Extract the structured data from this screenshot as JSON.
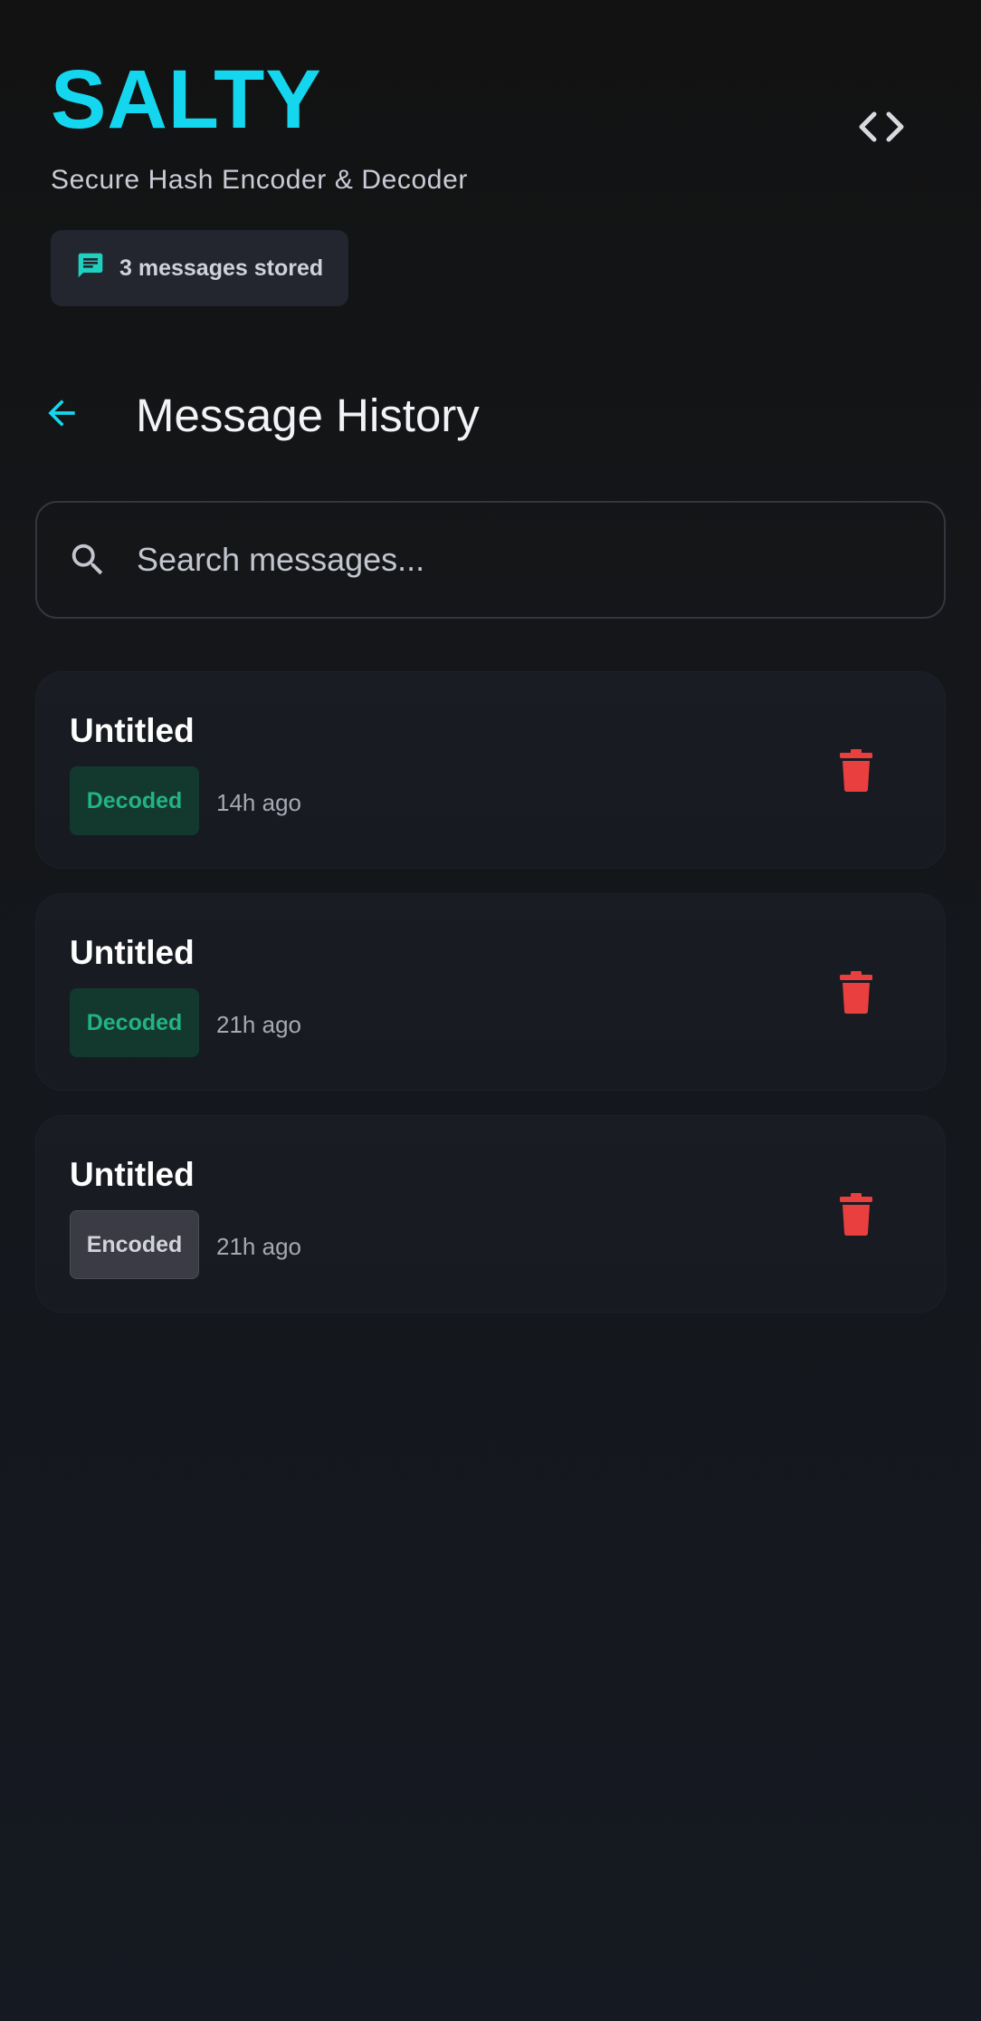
{
  "header": {
    "brand": "SALTY",
    "subtitle": "Secure Hash Encoder & Decoder",
    "badge_text": "3 messages stored",
    "badge_icon": "message-icon",
    "toggle_icon": "code-icon"
  },
  "page": {
    "title": "Message History",
    "back_icon": "arrow-left-icon"
  },
  "search": {
    "placeholder": "Search messages...",
    "value": "",
    "icon": "search-icon"
  },
  "messages": [
    {
      "title": "Untitled",
      "status": "Decoded",
      "time": "14h ago"
    },
    {
      "title": "Untitled",
      "status": "Decoded",
      "time": "21h ago"
    },
    {
      "title": "Untitled",
      "status": "Encoded",
      "time": "21h ago"
    }
  ],
  "colors": {
    "accent": "#14d7ef",
    "decoded_text": "#23b383",
    "decoded_bg": "#13392f",
    "encoded_bg": "#3a3b44",
    "delete": "#e9403f"
  }
}
